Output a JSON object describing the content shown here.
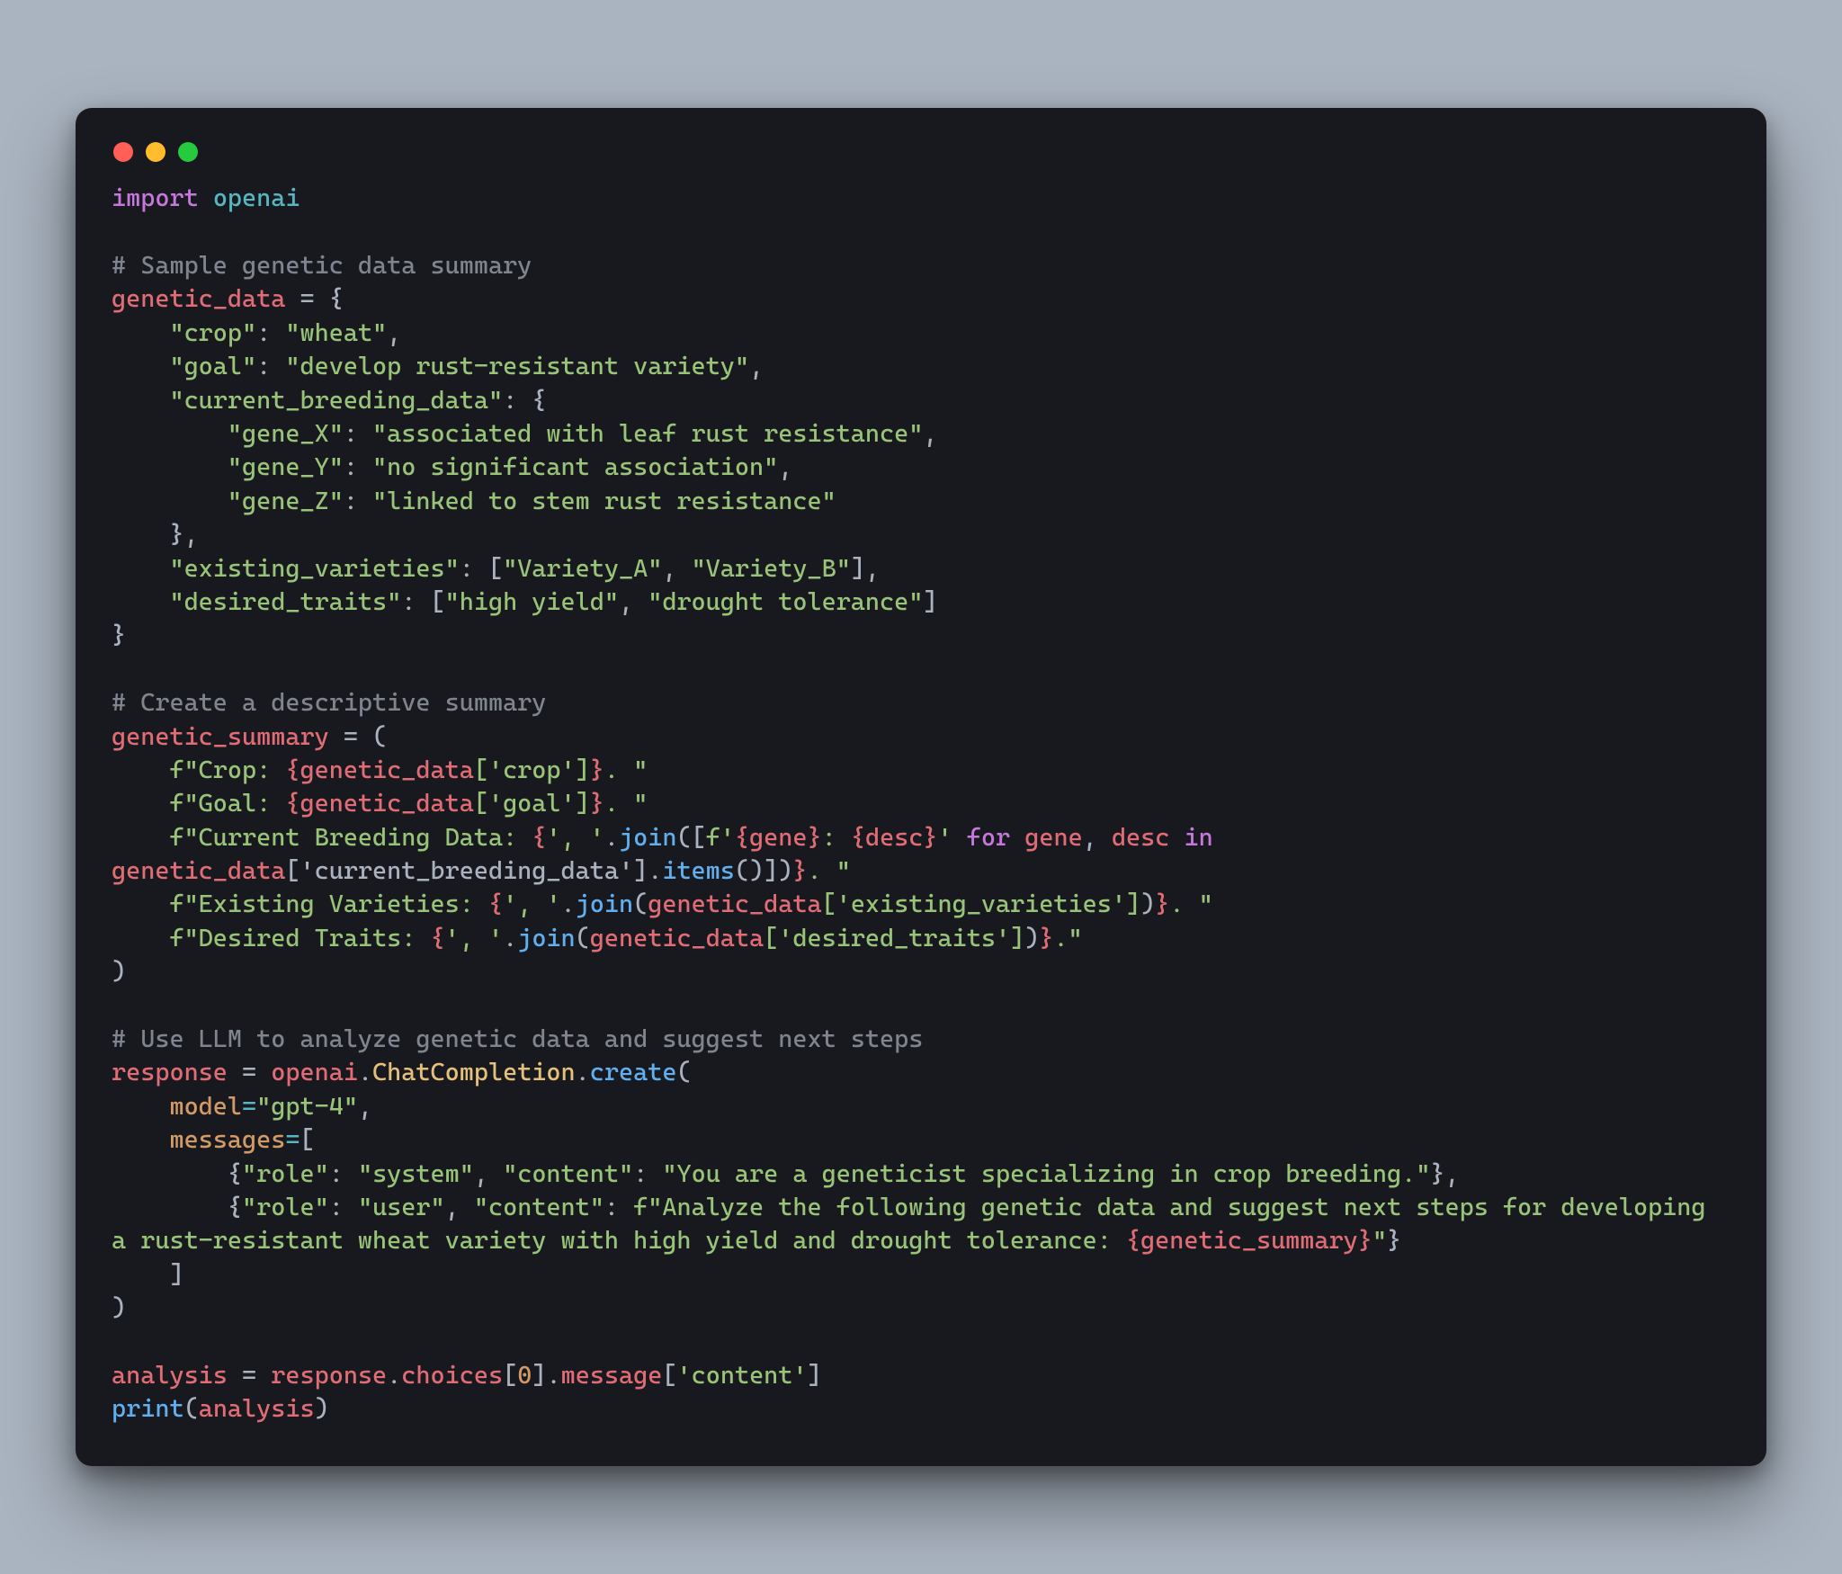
{
  "window": {
    "traffic_lights": [
      "red",
      "yellow",
      "green"
    ]
  },
  "code": {
    "import_kw": "import",
    "import_mod": "openai",
    "c1": "# Sample genetic data summary",
    "gd_var": "genetic_data",
    "eq": " = ",
    "brace_open": "{",
    "brace_close": "}",
    "bracket_open": "[",
    "bracket_close": "]",
    "paren_open": "(",
    "paren_close": ")",
    "comma": ",",
    "colon": ":",
    "dot": ".",
    "k_crop": "\"crop\"",
    "v_crop": "\"wheat\"",
    "k_goal": "\"goal\"",
    "v_goal": "\"develop rust-resistant variety\"",
    "k_cbd": "\"current_breeding_data\"",
    "k_gx": "\"gene_X\"",
    "v_gx": "\"associated with leaf rust resistance\"",
    "k_gy": "\"gene_Y\"",
    "v_gy": "\"no significant association\"",
    "k_gz": "\"gene_Z\"",
    "v_gz": "\"linked to stem rust resistance\"",
    "k_ev": "\"existing_varieties\"",
    "v_ev_a": "\"Variety_A\"",
    "v_ev_b": "\"Variety_B\"",
    "k_dt": "\"desired_traits\"",
    "v_dt_a": "\"high yield\"",
    "v_dt_b": "\"drought tolerance\"",
    "c2": "# Create a descriptive summary",
    "gs_var": "genetic_summary",
    "fs1_pre": "f\"Crop: ",
    "fs1_expr_open": "{",
    "fs1_expr_var": "genetic_data",
    "fs1_expr_idx": "['crop']",
    "fs1_expr_close": "}",
    "fs1_post": ". \"",
    "fs2_pre": "f\"Goal: ",
    "fs2_expr_idx": "['goal']",
    "fs2_post": ". \"",
    "fs3_pre": "f\"Current Breeding Data: ",
    "sep_str": "', '",
    "join_fn": "join",
    "fs3_inner_fpre": "f'",
    "fs3_inner_gene": "{gene}",
    "fs3_inner_colon": ": ",
    "fs3_inner_desc": "{desc}",
    "fs3_inner_fpost": "'",
    "for_kw": "for",
    "in_kw": "in",
    "gene_var": "gene",
    "desc_var": "desc",
    "cbd_idx": "['current_breeding_data']",
    "items_fn": "items",
    "fs3_post": ". \"",
    "fs4_pre": "f\"Existing Varieties: ",
    "ev_idx": "['existing_varieties']",
    "fs4_post": ". \"",
    "fs5_pre": "f\"Desired Traits: ",
    "dt_idx": "['desired_traits']",
    "fs5_post": ".\"",
    "c3": "# Use LLM to analyze genetic data and suggest next steps",
    "resp_var": "response",
    "openai_mod": "openai",
    "chatcomp": "ChatCompletion",
    "create_fn": "create",
    "model_param": "model",
    "model_val": "\"gpt-4\"",
    "messages_param": "messages",
    "msg1_role_k": "\"role\"",
    "msg1_role_v": "\"system\"",
    "msg1_cont_k": "\"content\"",
    "msg1_cont_v": "\"You are a geneticist specializing in crop breeding.\"",
    "msg2_role_v": "\"user\"",
    "msg2_cont_fpre": "f\"Analyze the following genetic data and suggest next steps for developing a rust-resistant wheat variety with high yield and drought tolerance: ",
    "msg2_cont_expr": "{genetic_summary}",
    "msg2_cont_fpost": "\"",
    "analysis_var": "analysis",
    "choices_attr": "choices",
    "zero": "0",
    "message_attr": "message",
    "content_idx": "['content']",
    "print_fn": "print"
  }
}
